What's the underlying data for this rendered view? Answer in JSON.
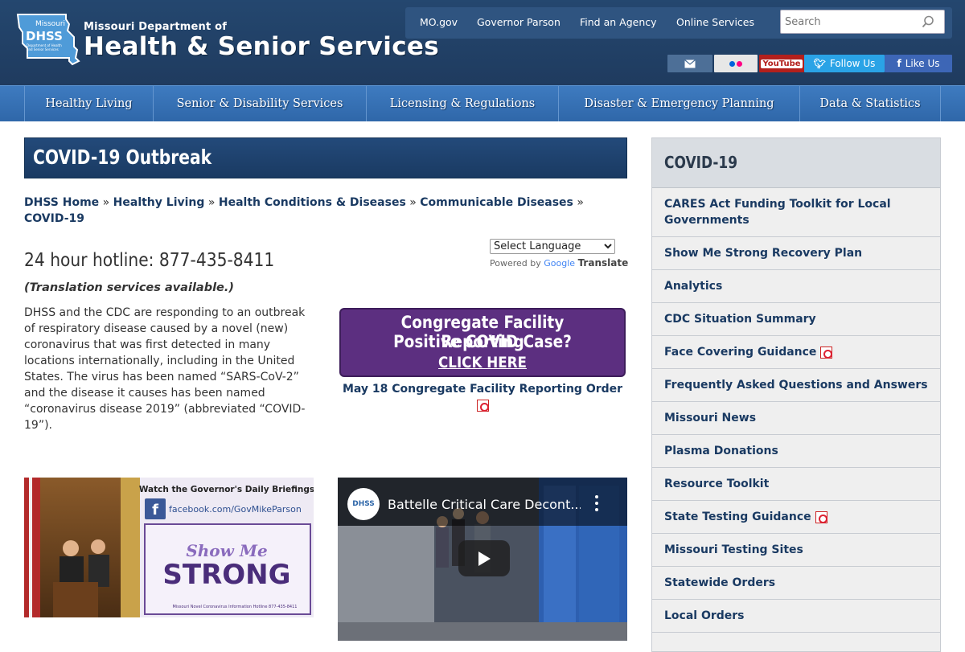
{
  "header": {
    "logo_badge": "DHSS",
    "logo_badge_sub": "Department of Health and Senior Services",
    "logo_state": "Missouri",
    "dept_line": "Missouri Department of",
    "name_line": "Health & Senior Services",
    "top_links": [
      "MO.gov",
      "Governor Parson",
      "Find an Agency",
      "Online Services"
    ],
    "search_placeholder": "Search",
    "social": {
      "twitter": "Follow Us",
      "facebook": "Like Us",
      "youtube": "YouTube"
    }
  },
  "nav": [
    "Healthy Living",
    "Senior & Disability Services",
    "Licensing & Regulations",
    "Disaster & Emergency Planning",
    "Data & Statistics"
  ],
  "main": {
    "title": "COVID-19 Outbreak",
    "breadcrumb": [
      "DHSS Home",
      "Healthy Living",
      "Health Conditions & Diseases",
      "Communicable Diseases",
      "COVID-19"
    ],
    "breadcrumb_sep": "»",
    "language_select": "Select Language",
    "powered_by": "Powered by",
    "google": "Google",
    "translate": "Translate",
    "hotline": "24 hour hotline: 877-435-8411",
    "translation_note": "(Translation services available.)",
    "intro": "DHSS and the CDC are responding to an outbreak of respiratory disease caused by a novel (new) coronavirus that was first detected in many locations internationally, including in the United States. The virus has been named “SARS-CoV-2” and the disease it causes has been named “coronavirus disease 2019” (abbreviated “COVID-19”).",
    "promo": {
      "line1": "Congregate Facility Reporting",
      "line2": "Positive COVID Case?",
      "line3": "CLICK HERE"
    },
    "order_link": "May 18 Congregate Facility Reporting Order",
    "gov_banner": {
      "watch": "Watch the Governor's Daily Briefings",
      "facebook": "facebook.com/GovMikeParson",
      "show_me": "Show Me",
      "strong": "STRONG",
      "hotline": "Missouri Novel Coronavirus Information Hotline 877-435-8411"
    },
    "video": {
      "title": "Battelle Critical Care Decont...",
      "channel_badge": "DHSS"
    }
  },
  "sidebar": {
    "title": "COVID-19",
    "items": [
      {
        "label": "CARES Act Funding Toolkit for Local Governments",
        "pdf": false
      },
      {
        "label": "Show Me Strong Recovery Plan",
        "pdf": false
      },
      {
        "label": "Analytics",
        "pdf": false
      },
      {
        "label": "CDC Situation Summary",
        "pdf": false
      },
      {
        "label": "Face Covering Guidance",
        "pdf": true
      },
      {
        "label": "Frequently Asked Questions and Answers",
        "pdf": false
      },
      {
        "label": "Missouri News",
        "pdf": false
      },
      {
        "label": "Plasma Donations",
        "pdf": false
      },
      {
        "label": "Resource Toolkit",
        "pdf": false
      },
      {
        "label": "State Testing Guidance",
        "pdf": true
      },
      {
        "label": "Missouri Testing Sites",
        "pdf": false
      },
      {
        "label": "Statewide Orders",
        "pdf": false
      },
      {
        "label": "Local Orders",
        "pdf": false
      }
    ]
  },
  "colors": {
    "header_bg": "#23456d",
    "nav_bg": "#3672b5",
    "title_bg": "#1f4270",
    "promo_purple": "#5c2f80",
    "link": "#1a3a62"
  }
}
